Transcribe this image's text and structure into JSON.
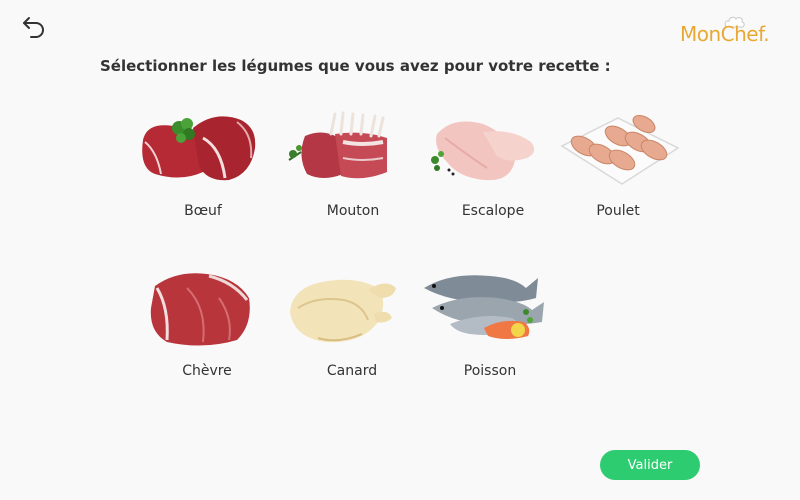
{
  "header": {
    "back_icon": "undo-arrow-icon",
    "logo_text": "MonChef.",
    "brand_color": "#e8a934"
  },
  "prompt": "Sélectionner les légumes que vous avez pour votre recette :",
  "items": [
    {
      "label": "Bœuf",
      "icon": "beef-image"
    },
    {
      "label": "Mouton",
      "icon": "lamb-rack-image"
    },
    {
      "label": "Escalope",
      "icon": "chicken-breast-image"
    },
    {
      "label": "Poulet",
      "icon": "chicken-legs-tray-image"
    },
    {
      "label": "Chèvre",
      "icon": "goat-meat-image"
    },
    {
      "label": "Canard",
      "icon": "whole-duck-image"
    },
    {
      "label": "Poisson",
      "icon": "fish-shrimp-image"
    }
  ],
  "validate_button": {
    "label": "Valider",
    "color": "#2ecc71"
  }
}
